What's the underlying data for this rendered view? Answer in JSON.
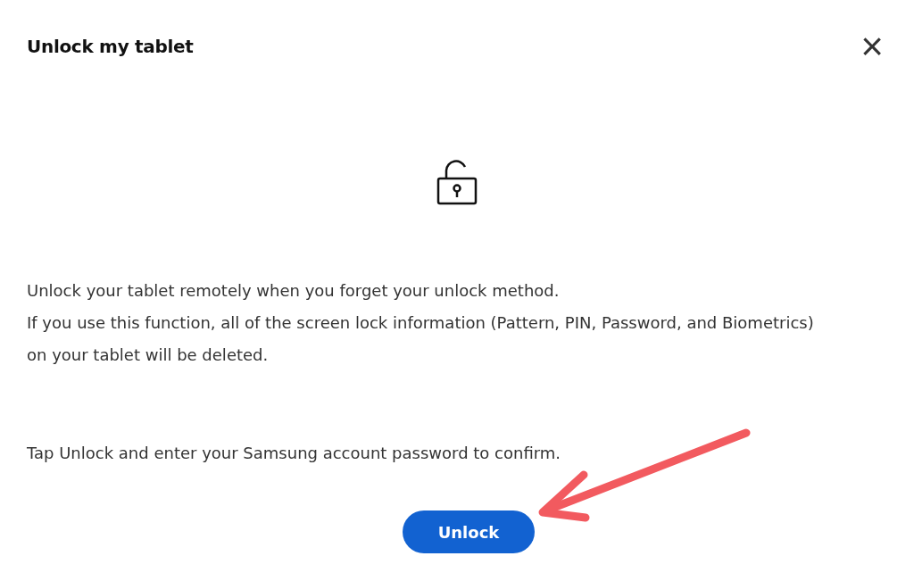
{
  "dialog": {
    "title": "Unlock my tablet",
    "close": "×"
  },
  "paragraphs": [
    "Unlock your tablet remotely when you forget your unlock method.",
    "If you use this function, all of the screen lock information (Pattern, PIN, Password, and Biometrics) on your tablet will be deleted.",
    "Tap Unlock and enter your Samsung account password to confirm."
  ],
  "button": {
    "label": "Unlock"
  }
}
